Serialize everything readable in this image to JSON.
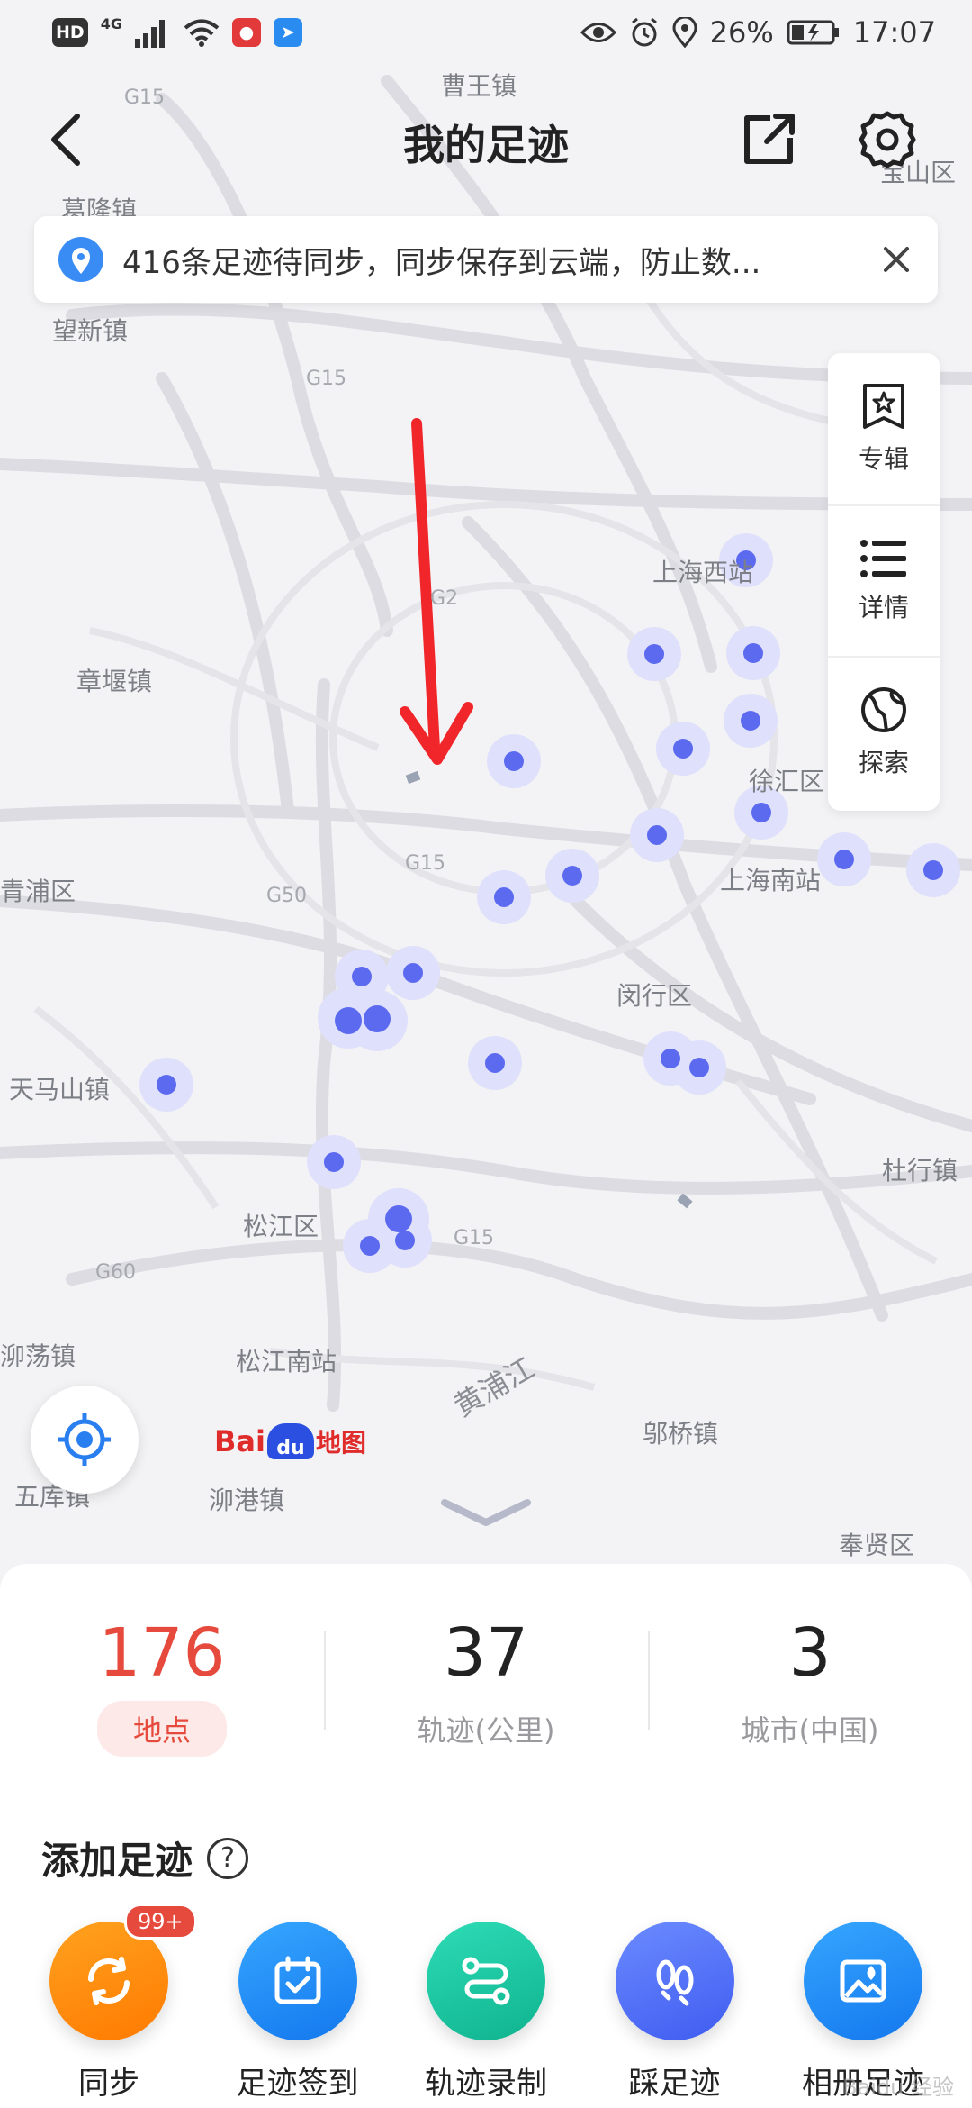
{
  "status_bar": {
    "left_badges": [
      "HD",
      "4G"
    ],
    "right": {
      "battery": "26%",
      "time": "17:07"
    },
    "icons": [
      "eye-icon",
      "alarm-icon",
      "location-pin-icon",
      "battery-icon"
    ]
  },
  "header": {
    "title": "我的足迹",
    "back_icon": "back-arrow-icon",
    "share_icon": "share-icon",
    "settings_icon": "gear-icon"
  },
  "sync_banner": {
    "text": "416条足迹待同步，同步保存到云端，防止数...",
    "icon": "location-pin-icon",
    "close_icon": "close-icon"
  },
  "side_panel": {
    "items": [
      {
        "label": "专辑",
        "icon": "album-star-icon"
      },
      {
        "label": "详情",
        "icon": "list-icon"
      },
      {
        "label": "探索",
        "icon": "explore-globe-icon"
      }
    ]
  },
  "map": {
    "places": [
      "曹王镇",
      "葛隆镇",
      "宝山区",
      "望新镇",
      "上海西站",
      "章堰镇",
      "徐汇区",
      "青浦区",
      "上海南站",
      "闵行区",
      "天马山镇",
      "杜行镇",
      "松江区",
      "泖荡镇",
      "松江南站",
      "黄浦江",
      "邬桥镇",
      "五库镇",
      "泖港镇",
      "奉贤区"
    ],
    "roads": [
      "G15",
      "G15",
      "G2",
      "G15",
      "G50",
      "G15",
      "G60"
    ],
    "logo_text": {
      "bai": "Bai",
      "du": "du",
      "map": "地图"
    }
  },
  "stats": [
    {
      "value": "176",
      "label": "地点",
      "active": true
    },
    {
      "value": "37",
      "label": "轨迹(公里)",
      "active": false
    },
    {
      "value": "3",
      "label": "城市(中国)",
      "active": false
    }
  ],
  "add_section": {
    "title": "添加足迹",
    "help_icon": "help-circle-icon",
    "help_glyph": "?"
  },
  "actions": [
    {
      "label": "同步",
      "icon": "sync-icon",
      "color": "#ff8a00",
      "badge": "99+"
    },
    {
      "label": "足迹签到",
      "icon": "calendar-check-icon",
      "color": "#1e88f5"
    },
    {
      "label": "轨迹录制",
      "icon": "route-icon",
      "color": "#19c3a0"
    },
    {
      "label": "踩足迹",
      "icon": "footprint-icon",
      "color": "#4a6cf7"
    },
    {
      "label": "相册足迹",
      "icon": "photo-album-icon",
      "color": "#1e88f5"
    }
  ],
  "watermark": "Baidu 经验"
}
